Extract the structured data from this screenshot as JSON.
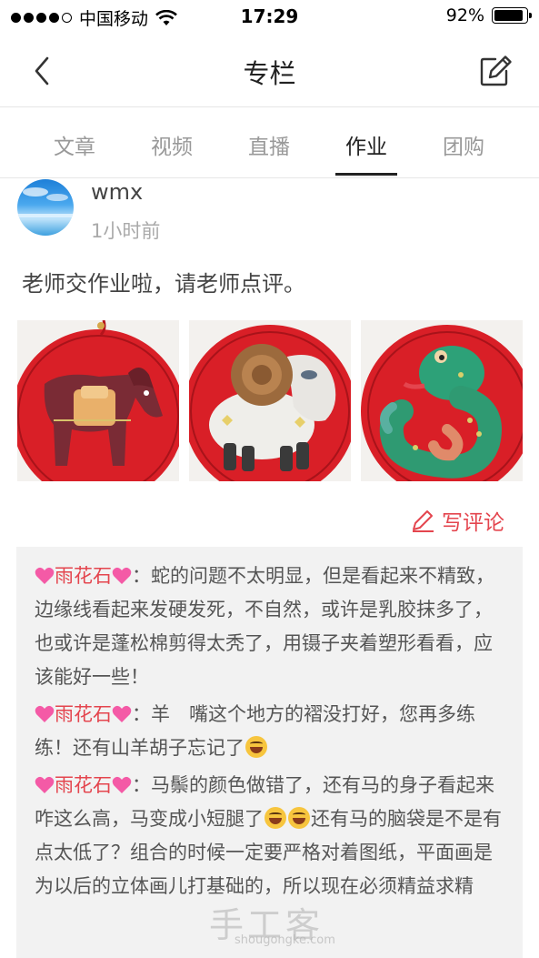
{
  "status_bar": {
    "carrier": "中国移动",
    "time": "17:29",
    "battery": "92%"
  },
  "nav": {
    "title": "专栏"
  },
  "tabs": [
    {
      "label": "文章",
      "active": false
    },
    {
      "label": "视频",
      "active": false
    },
    {
      "label": "直播",
      "active": false
    },
    {
      "label": "作业",
      "active": true
    },
    {
      "label": "团购",
      "active": false
    }
  ],
  "post": {
    "username": "wmx",
    "time_ago": "1小时前",
    "text": "老师交作业啦，请老师点评。",
    "images": [
      "horse-craft",
      "sheep-craft",
      "snake-craft"
    ],
    "write_comment": "写评论"
  },
  "comments": [
    {
      "author": "雨花石",
      "text": "：蛇的问题不太明显，但是看起来不精致，边缘线看起来发硬发死，不自然，或许是乳胶抹多了，也或许是蓬松棉剪得太秃了，用镊子夹着塑形看看，应该能好一些！",
      "trailing_emoji": 0
    },
    {
      "author": "雨花石",
      "text": "：羊　嘴这个地方的褶没打好，您再多练练！还有山羊胡子忘记了",
      "trailing_emoji": 1
    },
    {
      "author": "雨花石",
      "text_a": "：马鬃的颜色做错了，还有马的身子看起来咋这么高，马变成小短腿了",
      "text_b": "还有马的脑袋是不是有点太低了？组合的时候一定要严格对着图纸，平面画是为以后的立体画儿打基础的，所以现在必须精益求精"
    }
  ],
  "watermark": {
    "main": "手工客",
    "sub": "shougongke.com"
  },
  "colors": {
    "accent": "#e4454e",
    "comment_bg": "#f2f2f2"
  }
}
